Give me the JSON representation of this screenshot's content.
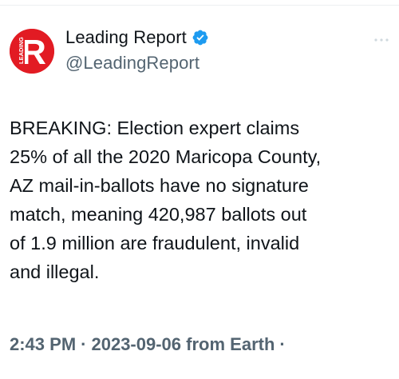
{
  "account": {
    "display_name": "Leading Report",
    "handle": "@LeadingReport",
    "verified": true,
    "avatar_letter": "R",
    "avatar_side_text": "LEADING",
    "avatar_color": "#e21b23",
    "verified_color": "#1d9bf0"
  },
  "tweet": {
    "lines": [
      "BREAKING: Election expert claims",
      "25% of all the 2020 Maricopa County,",
      "AZ mail-in-ballots have no signature",
      "match, meaning 420,987 ballots out",
      "of 1.9 million are fraudulent, invalid",
      "and illegal."
    ]
  },
  "meta": {
    "time": "2:43 PM",
    "separator": "·",
    "date": "2023-09-06",
    "source": "from Earth",
    "trailing_separator": "·"
  },
  "icons": {
    "more": "more-options-icon",
    "verified": "verified-badge-icon"
  }
}
